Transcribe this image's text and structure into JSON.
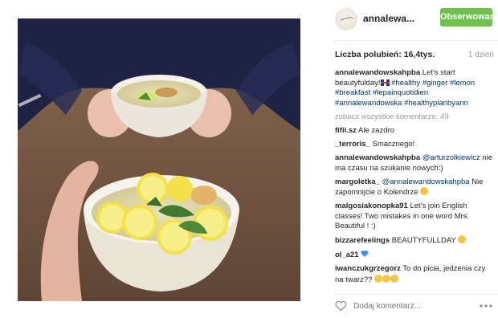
{
  "post": {
    "username": "annalewa...",
    "follow_label": "Obserwowanie",
    "likes": "Liczba polubień: 16,4tys.",
    "timestamp": "1 dzień",
    "caption": {
      "user": "annalewandowskahpba",
      "text_1": " Let's start beautyfulday!",
      "hashtags_1": "#healthy #ginger",
      "hashtags_2": "#lemon #breakfast #lepainquotidien",
      "hashtags_3": "#annalewandowska #healthyplanbyann"
    },
    "view_all_comments": "zobacz wszystkie komentarze: 49",
    "comments": [
      {
        "user": "fifii.sz",
        "text": "Ale zazdro"
      },
      {
        "user": "_terroris_",
        "text": "Smacznego!"
      },
      {
        "user": "annalewandowskahpba",
        "mention": "@arturzolkiewicz",
        "text": " nie ma czasu na szukanie nowych:)"
      },
      {
        "user": "margoletka_",
        "mention": "@annalewandowskahpba",
        "text": " Nie zapomnijcie o Kolendrze"
      },
      {
        "user": "malgosiakonopka91",
        "text": "Let's join English classes! Two mistakes in one word Mrs. Beautiful ! :)"
      },
      {
        "user": "bizzarefeelings",
        "text": "BEAUTYFULLDAY"
      },
      {
        "user": "ol_a21",
        "text": ""
      },
      {
        "user": "iwanczukgrzegorz",
        "text": "To do picia, jedzenia czy na twarz??"
      }
    ],
    "comment_placeholder": "Dodaj komentarz...",
    "more_options": "···"
  },
  "colors": {
    "follow_button": "#70c050",
    "hashtag": "#003569",
    "muted": "#999999",
    "text": "#262626"
  }
}
